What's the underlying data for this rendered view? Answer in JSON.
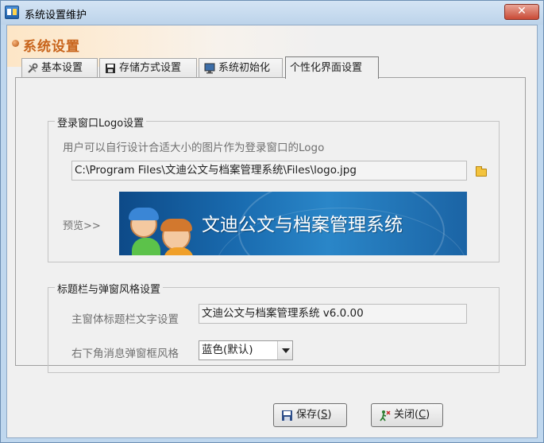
{
  "window": {
    "title": "系统设置维护",
    "close_label": "✕"
  },
  "banner": {
    "title": "系统设置"
  },
  "tabs": [
    {
      "label": "基本设置",
      "icon": "tools-icon"
    },
    {
      "label": "存储方式设置",
      "icon": "floppy-disk-icon"
    },
    {
      "label": "系统初始化",
      "icon": "monitor-icon"
    },
    {
      "label": "个性化界面设置",
      "active": true
    }
  ],
  "logo_group": {
    "title": "登录窗口Logo设置",
    "hint": "用户可以自行设计合适大小的图片作为登录窗口的Logo",
    "path_value": "C:\\Program Files\\文迪公文与档案管理系统\\Files\\logo.jpg",
    "preview_label": "预览>>",
    "preview_text": "文迪公文与档案管理系统"
  },
  "style_group": {
    "title": "标题栏与弹窗风格设置",
    "caption_label": "主窗体标题栏文字设置",
    "caption_value": "文迪公文与档案管理系统 v6.0.00",
    "popup_label": "右下角消息弹窗框风格",
    "popup_selected": "蓝色(默认)"
  },
  "buttons": {
    "save_prefix": "保存(",
    "save_key": "S",
    "save_suffix": ")",
    "close_prefix": "关闭(",
    "close_key": "C",
    "close_suffix": ")"
  },
  "colors": {
    "banner_title": "#c8641b",
    "logo_background": "#1a6cb0",
    "window_frame": "#bfd7ee"
  }
}
